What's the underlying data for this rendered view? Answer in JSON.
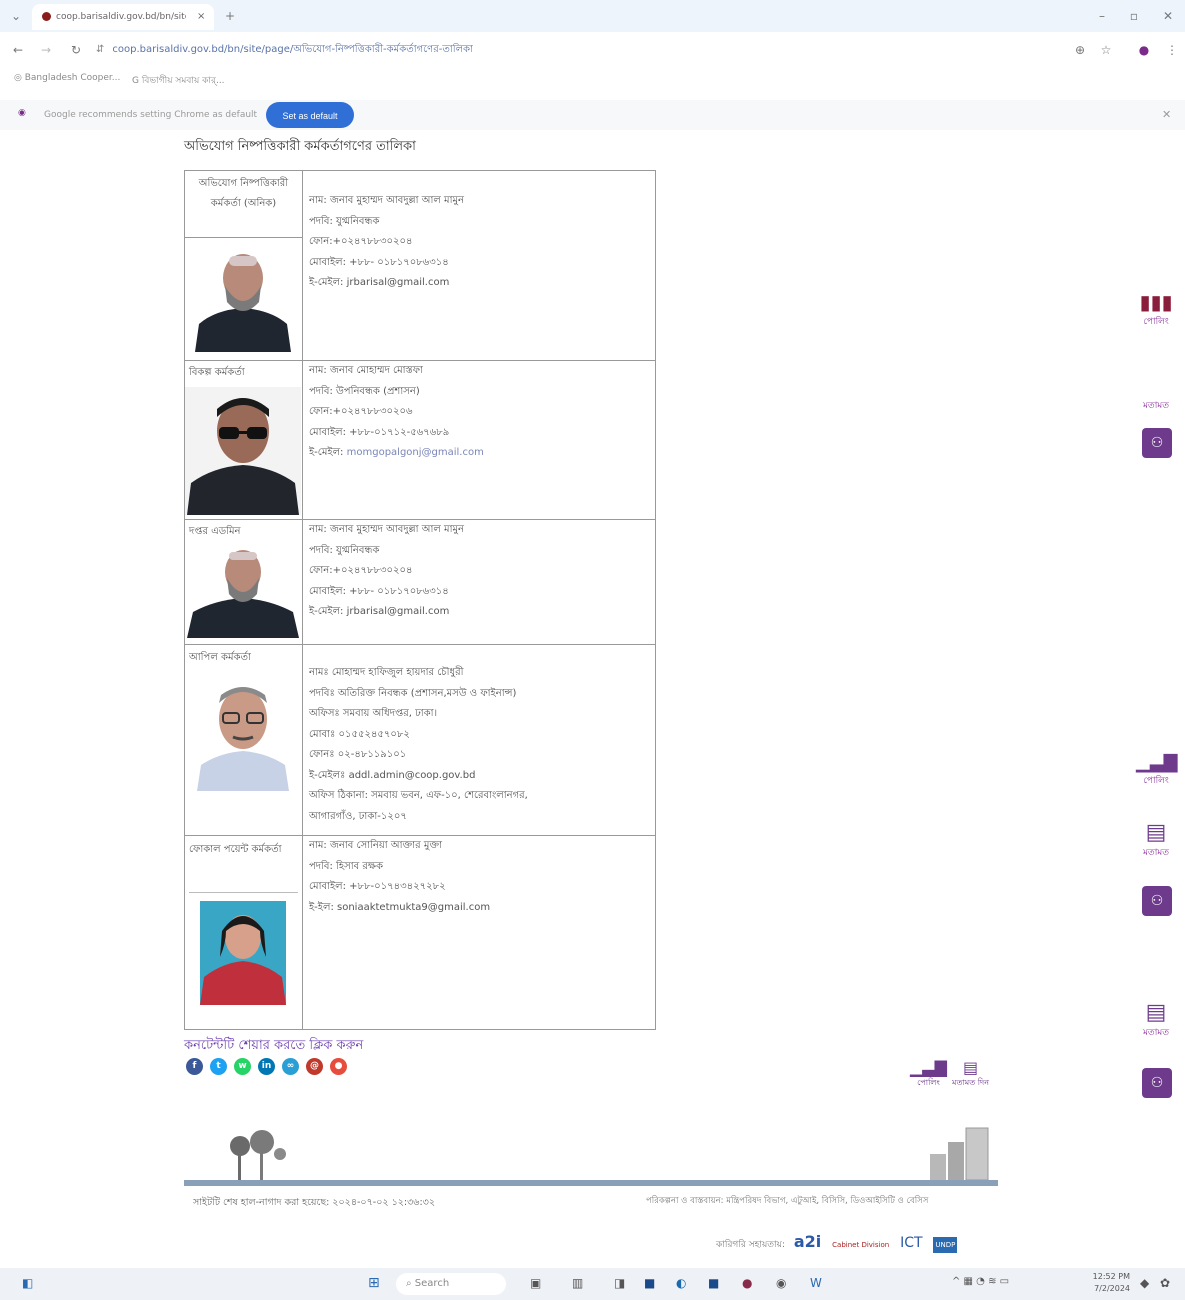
{
  "browser": {
    "tab_title": "coop.barisaldiv.gov.bd/bn/site",
    "tab_close": "×",
    "new_tab": "+",
    "url": "coop.barisaldiv.gov.bd/bn/site/page/অভিযোগ-নিষ্পত্তিকারী-কর্মকর্তাগণের-তালিকা",
    "bookmarks": [
      "Bangladesh Cooper...",
      "বিভাগীয় সমবায় কার্..."
    ],
    "infobar_text": "Google recommends setting Chrome as default",
    "set_default_label": "Set as default"
  },
  "page": {
    "title": "অভিযোগ নিষ্পত্তিকারী কর্মকর্তাগণের তালিকা"
  },
  "officers": [
    {
      "role": "অভিযোগ নিষ্পত্তিকারী কর্মকর্তা (অনিক)",
      "lines": [
        "নাম: জনাব মুহাম্মদ আবদুল্লা আল মামুন",
        "পদবি: যুগ্মনিবন্ধক",
        "ফোন:+০২৪৭৮৮৩০২০৪",
        "মোবাইল: +৮৮- ০১৮১৭০৮৬৩১৪"
      ],
      "email_prefix": "ই-মেইল:",
      "email": "jrbarisal@gmail.com"
    },
    {
      "role": "বিকল্প কর্মকর্তা",
      "lines": [
        "নাম: জনাব মোহাম্মদ মোস্তফা",
        "পদবি: উপনিবন্ধক (প্রশাসন)",
        "ফোন:+০২৪৭৮৮৩০২০৬",
        "মোবাইল: +৮৮-০১৭১২-৫৬৭৬৮৯"
      ],
      "email_prefix": "ই-মেইল:",
      "email": "momgopalgonj@gmail.com"
    },
    {
      "role": "দপ্তর এডমিন",
      "lines": [
        "নাম: জনাব মুহাম্মদ আবদুল্লা আল মামুন",
        "পদবি: যুগ্মনিবন্ধক",
        "ফোন:+০২৪৭৮৮৩০২০৪",
        "মোবাইল: +৮৮- ০১৮১৭০৮৬৩১৪"
      ],
      "email_prefix": "ই-মেইল:",
      "email": "jrbarisal@gmail.com"
    },
    {
      "role": "আপিল কর্মকর্তা",
      "lines": [
        "নামঃ মোহাম্মদ হাফিজুল হায়দার চৌধুরী",
        "পদবিঃ অতিরিক্ত নিবন্ধক (প্রশাসন,মসউ ও ফাইনান্স)",
        "অফিসঃ সমবায় অধিদপ্তর, ঢাকা।",
        "মোবাঃ ০১৫৫২৪৫৭০৮২",
        "ফোনঃ ০২-৪৮১১৯১০১"
      ],
      "email_prefix": "ই-মেইলঃ",
      "email": "addl.admin@coop.gov.bd",
      "extra": [
        "অফিস ঠিকানা: সমবায় ভবন, এফ-১০, শেরেবাংলানগর,",
        "আগারগাঁও, ঢাকা-১২০৭"
      ]
    },
    {
      "role": "ফোকাল পয়েন্ট কর্মকর্তা",
      "lines": [
        "নাম: জনাব সোনিয়া আক্তার মুক্তা",
        "পদবি: হিসাব রক্ষক",
        "মোবাইল: +৮৮-০১৭৪৩৪২৭২৮২"
      ],
      "email_prefix": "ই-ইল:",
      "email": "soniaaktetmukta9@gmail.com"
    }
  ],
  "right_widgets": [
    {
      "label": "পোলিং"
    },
    {
      "label": "মতামত"
    },
    {
      "label": "পোলিং"
    },
    {
      "label": "মতামত"
    },
    {
      "label": "মতামত"
    }
  ],
  "share": {
    "title": "কনটেন্টটি শেয়ার করতে ক্লিক করুন",
    "icons": [
      {
        "name": "facebook-icon",
        "glyph": "f",
        "color": "#3b5998"
      },
      {
        "name": "twitter-icon",
        "glyph": "t",
        "color": "#1da1f2"
      },
      {
        "name": "whatsapp-icon",
        "glyph": "w",
        "color": "#25d366"
      },
      {
        "name": "linkedin-icon",
        "glyph": "in",
        "color": "#0077b5"
      },
      {
        "name": "link-icon",
        "glyph": "∞",
        "color": "#2a9fd6"
      },
      {
        "name": "email-icon",
        "glyph": "@",
        "color": "#c0392b"
      },
      {
        "name": "print-icon",
        "glyph": "●",
        "color": "#e74c3c"
      }
    ],
    "poll_label": "পোলিং",
    "feedback_label": "মতামত দিন"
  },
  "footer": {
    "updated": "সাইটটি শেষ হাল-নাগাদ করা হয়েছে: ২০২৪-০৭-০২ ১২:৩৬:৩২",
    "planning": "পরিকল্পনা ও বাস্তবায়ন: মন্ত্রিপরিষদ বিভাগ, এটুআই, বিসিসি, ডিওআইসিটি ও বেসিস",
    "support": "কারিগরি সহায়তায়:",
    "logos": [
      "a2i",
      "Cabinet Division",
      "ICT",
      "UNDP"
    ]
  },
  "taskbar": {
    "search": "Search",
    "time": "12:52 PM",
    "date": "7/2/2024"
  },
  "colors": {
    "accent": "#2f6fd6",
    "widget_purple": "#6d3a8c",
    "share_title": "#6a3db0"
  }
}
